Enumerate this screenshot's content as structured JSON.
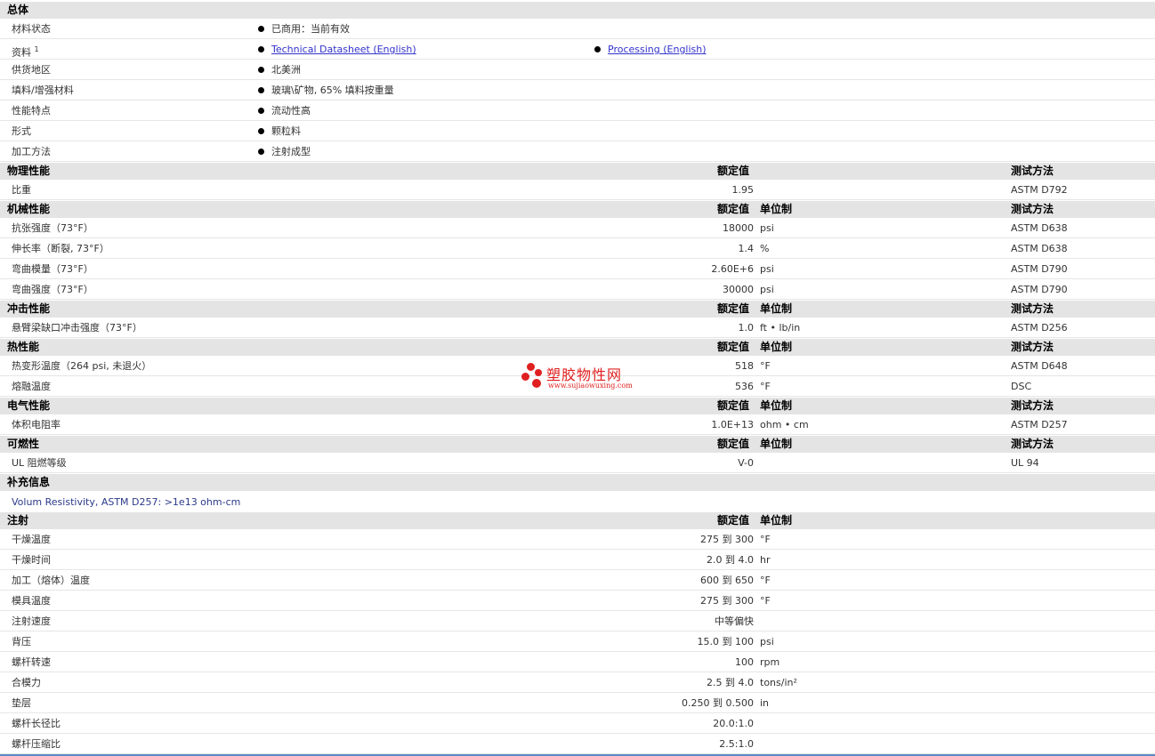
{
  "general": {
    "title": "总体",
    "rows": [
      {
        "label": "材料状态",
        "values": [
          "已商用：当前有效"
        ]
      },
      {
        "label": "资料",
        "sup": "1",
        "links": [
          "Technical Datasheet (English)",
          "Processing (English)"
        ]
      },
      {
        "label": "供货地区",
        "values": [
          "北美洲"
        ]
      },
      {
        "label": "填料/增强材料",
        "values": [
          "玻璃\\矿物, 65% 填料按重量"
        ]
      },
      {
        "label": "性能特点",
        "values": [
          "流动性高"
        ]
      },
      {
        "label": "形式",
        "values": [
          "颗粒料"
        ]
      },
      {
        "label": "加工方法",
        "values": [
          "注射成型"
        ]
      }
    ]
  },
  "columns": {
    "nominal": "额定值",
    "unit": "单位制",
    "test": "测试方法"
  },
  "physical": {
    "title": "物理性能",
    "rows": [
      {
        "label": "比重",
        "value": "1.95",
        "unit": "",
        "test": "ASTM D792"
      }
    ]
  },
  "mechanical": {
    "title": "机械性能",
    "rows": [
      {
        "label": "抗张强度（73°F）",
        "value": "18000",
        "unit": "psi",
        "test": "ASTM D638"
      },
      {
        "label": "伸长率（断裂, 73°F）",
        "value": "1.4",
        "unit": "%",
        "test": "ASTM D638"
      },
      {
        "label": "弯曲模量（73°F）",
        "value": "2.60E+6",
        "unit": "psi",
        "test": "ASTM D790"
      },
      {
        "label": "弯曲强度（73°F）",
        "value": "30000",
        "unit": "psi",
        "test": "ASTM D790"
      }
    ]
  },
  "impact": {
    "title": "冲击性能",
    "rows": [
      {
        "label": "悬臂梁缺口冲击强度（73°F）",
        "value": "1.0",
        "unit": "ft • lb/in",
        "test": "ASTM D256"
      }
    ]
  },
  "thermal": {
    "title": "热性能",
    "rows": [
      {
        "label": "热变形温度（264 psi, 未退火）",
        "value": "518",
        "unit": "°F",
        "test": "ASTM D648"
      },
      {
        "label": "熔融温度",
        "value": "536",
        "unit": "°F",
        "test": "DSC"
      }
    ]
  },
  "electrical": {
    "title": "电气性能",
    "rows": [
      {
        "label": "体积电阻率",
        "value": "1.0E+13",
        "unit": "ohm • cm",
        "test": "ASTM D257"
      }
    ]
  },
  "flammability": {
    "title": "可燃性",
    "rows": [
      {
        "label": "UL 阻燃等级",
        "value": "V-0",
        "unit": "",
        "test": "UL 94"
      }
    ]
  },
  "supplement": {
    "title": "补充信息",
    "note": "Volum Resistivity, ASTM D257: >1e13 ohm-cm"
  },
  "injection": {
    "title": "注射",
    "rows": [
      {
        "label": "干燥温度",
        "value": "275 到  300",
        "unit": "°F"
      },
      {
        "label": "干燥时间",
        "value": "2.0 到  4.0",
        "unit": "hr"
      },
      {
        "label": "加工（熔体）温度",
        "value": "600 到  650",
        "unit": "°F"
      },
      {
        "label": "模具温度",
        "value": "275 到  300",
        "unit": "°F"
      },
      {
        "label": "注射速度",
        "value": "中等偏快",
        "unit": ""
      },
      {
        "label": "背压",
        "value": "15.0 到  100",
        "unit": "psi"
      },
      {
        "label": "螺杆转速",
        "value": "100",
        "unit": "rpm"
      },
      {
        "label": "合模力",
        "value": "2.5 到  4.0",
        "unit": "tons/in²"
      },
      {
        "label": "垫层",
        "value": "0.250 到  0.500",
        "unit": "in"
      },
      {
        "label": "螺杆长径比",
        "value": "20.0:1.0",
        "unit": ""
      },
      {
        "label": "螺杆压缩比",
        "value": "2.5:1.0",
        "unit": ""
      }
    ]
  },
  "watermark": {
    "name": "塑胶物性网",
    "url": "www.sujiaowuxing.com",
    "color": "#e02020"
  }
}
